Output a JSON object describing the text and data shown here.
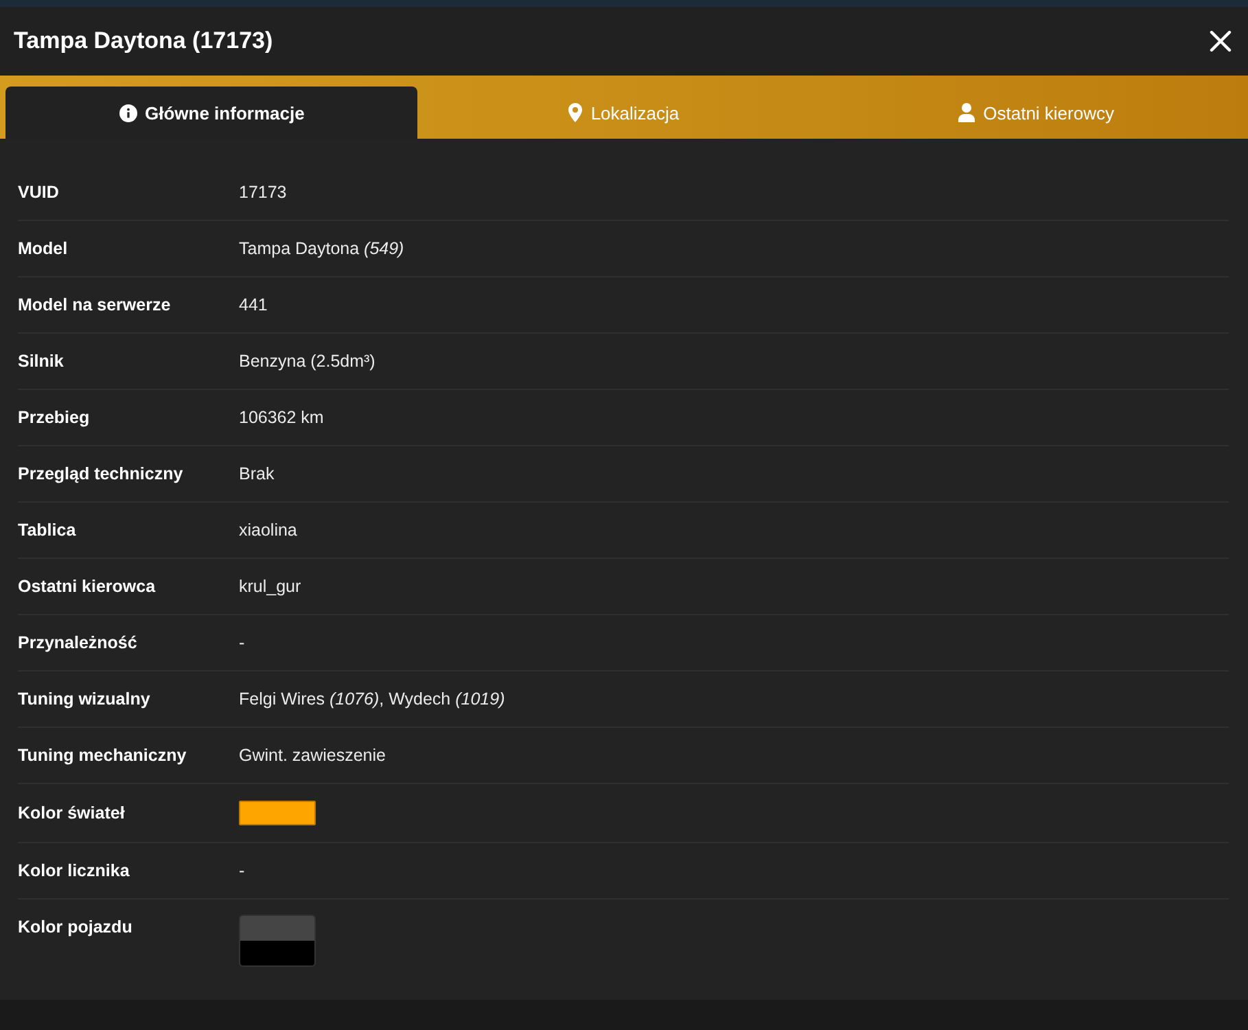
{
  "window": {
    "title": "Tampa Daytona (17173)"
  },
  "tabs": [
    {
      "label": "Główne informacje",
      "selected": true
    },
    {
      "label": "Lokalizacja",
      "selected": false
    },
    {
      "label": "Ostatni kierowcy",
      "selected": false
    }
  ],
  "rows": [
    {
      "kind": "text",
      "label": "VUID",
      "value": "17173"
    },
    {
      "kind": "text",
      "label": "Model",
      "value": "Tampa Daytona *(549)*"
    },
    {
      "kind": "text",
      "label": "Model na serwerze",
      "value": "441"
    },
    {
      "kind": "text",
      "label": "Silnik",
      "value": "Benzyna (2.5dm³)"
    },
    {
      "kind": "text",
      "label": "Przebieg",
      "value": "106362 km"
    },
    {
      "kind": "text",
      "label": "Przegląd techniczny",
      "value": "Brak"
    },
    {
      "kind": "text",
      "label": "Tablica",
      "value": "xiaolina"
    },
    {
      "kind": "text",
      "label": "Ostatni kierowca",
      "value": "krul_gur"
    },
    {
      "kind": "text",
      "label": "Przynależność",
      "value": "-"
    },
    {
      "kind": "text",
      "label": "Tuning wizualny",
      "value": "Felgi Wires *(1076)*, Wydech *(1019)*"
    },
    {
      "kind": "text",
      "label": "Tuning mechaniczny",
      "value": "Gwint. zawieszenie"
    },
    {
      "kind": "swatch",
      "label": "Kolor świateł",
      "swatches": [
        {
          "color": "#ffa500"
        }
      ]
    },
    {
      "kind": "text",
      "label": "Kolor licznika",
      "value": "-"
    },
    {
      "kind": "swatch",
      "label": "Kolor pojazdu",
      "swatches": [
        {
          "color": "#454545"
        },
        {
          "color": "#000000"
        }
      ]
    }
  ]
}
